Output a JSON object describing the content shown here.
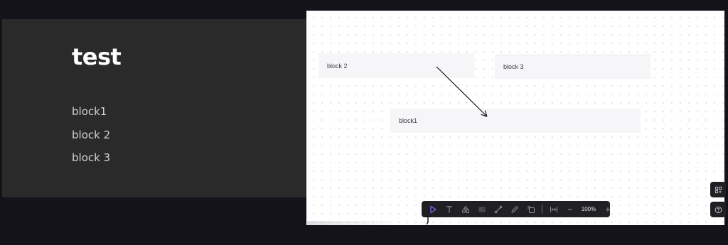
{
  "document": {
    "title": "test",
    "items": [
      {
        "label": "block1"
      },
      {
        "label": "block 2"
      },
      {
        "label": "block 3"
      }
    ]
  },
  "canvas": {
    "blocks": {
      "block_2": "block 2",
      "block_3": "block 3",
      "block_1": "block1"
    }
  },
  "toolbar": {
    "tools": [
      "select-icon",
      "text-icon",
      "shapes-icon",
      "image-icon",
      "connector-icon",
      "pen-icon",
      "lasso-icon",
      "fit-width-icon"
    ],
    "active_tool": "select-icon",
    "zoom": "100%"
  },
  "colors": {
    "background": "#14121a",
    "doc_panel": "#2a2a2a",
    "canvas": "#ffffff",
    "block_fill": "#f6f6f8",
    "toolbar": "#202024",
    "accent": "#7b6cf6"
  }
}
